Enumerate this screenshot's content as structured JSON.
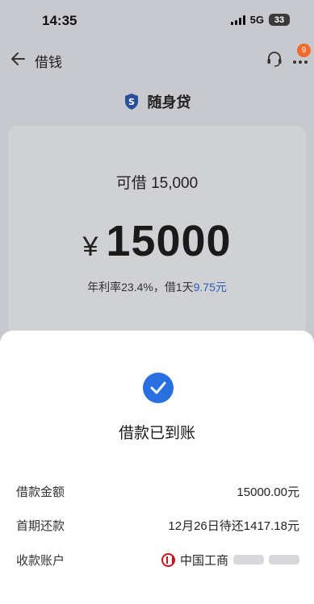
{
  "status_bar": {
    "time": "14:35",
    "network": "5G",
    "battery": "33"
  },
  "nav": {
    "title": "借钱",
    "badge": "9"
  },
  "product": {
    "name": "随身贷"
  },
  "loan_card": {
    "limit_text": "可借 15,000",
    "currency": "¥",
    "amount": "15000",
    "rate_text": "年利率23.4%，借1天",
    "rate_cost": "9.75元"
  },
  "sheet": {
    "title": "借款已到账",
    "rows": [
      {
        "label": "借款金额",
        "value": "15000.00元"
      },
      {
        "label": "首期还款",
        "value": "12月26日待还1417.18元"
      },
      {
        "label": "收款账户",
        "value": "中国工商"
      }
    ]
  },
  "colors": {
    "accent_blue": "#2a6fe0",
    "badge_orange": "#f26a2c",
    "bank_red": "#c8161d"
  }
}
